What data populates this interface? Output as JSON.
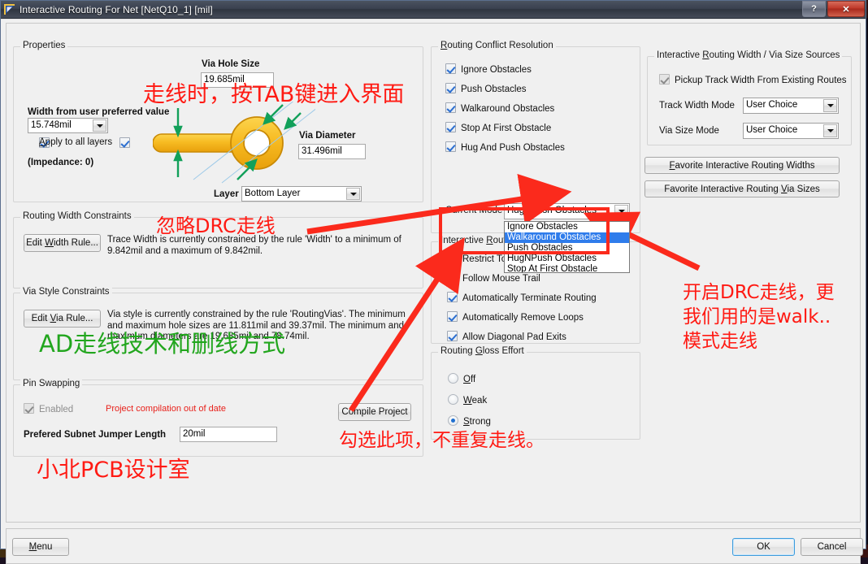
{
  "window": {
    "title": "Interactive Routing For Net [NetQ10_1] [mil]",
    "icon": "altium-pcb-icon",
    "help_label": "?",
    "close_label": "✕"
  },
  "properties": {
    "group_title": "Properties",
    "via_hole_size_label": "Via Hole Size",
    "via_hole_size_value": "19.685mil",
    "via_diameter_label": "Via Diameter",
    "via_diameter_value": "31.496mil",
    "width_label": "Width from user preferred value",
    "width_value": "15.748mil",
    "apply_all_layers_label": "Apply to all layers",
    "impedance_label": "(Impedance: 0)",
    "layer_label": "Layer",
    "layer_value": "Bottom Layer"
  },
  "routing_width_constraints": {
    "group_title": "Routing Width Constraints",
    "edit_button": "Edit Width Rule...",
    "description": "Trace Width is currently constrained by the rule 'Width' to a minimum of 9.842mil and a maximum of 9.842mil."
  },
  "via_style_constraints": {
    "group_title": "Via Style Constraints",
    "edit_button": "Edit Via Rule...",
    "description": "Via style is currently constrained by the rule 'RoutingVias'. The minimum and maximum hole sizes are 11.811mil and 39.37mil. The minimum and maximum diameters are 19.685mil and 78.74mil."
  },
  "pin_swapping": {
    "group_title": "Pin Swapping",
    "enabled_label": "Enabled",
    "warning": "Project compilation out of date",
    "compile_button": "Compile Project",
    "jumper_label": "Prefered Subnet Jumper Length",
    "jumper_value": "20mil"
  },
  "conflict_resolution": {
    "group_title": "Routing Conflict Resolution",
    "items": [
      {
        "label": "Ignore Obstacles",
        "checked": true
      },
      {
        "label": "Push Obstacles",
        "checked": true
      },
      {
        "label": "Walkaround Obstacles",
        "checked": true
      },
      {
        "label": "Stop At First Obstacle",
        "checked": true
      },
      {
        "label": "Hug And Push Obstacles",
        "checked": true
      }
    ],
    "current_mode_label": "Current Mode",
    "current_mode_value": "HugNPush Obstacles",
    "dropdown_options": [
      "Ignore Obstacles",
      "Walkaround Obstacles",
      "Push Obstacles",
      "HugNPush Obstacles",
      "Stop At First Obstacle"
    ],
    "dropdown_selected": "Walkaround Obstacles"
  },
  "routing_options": {
    "group_title": "Interactive Routing Options",
    "items": [
      {
        "label": "Restrict To 90/45",
        "checked": false
      },
      {
        "label": "Follow Mouse Trail",
        "checked": false
      },
      {
        "label": "Automatically Terminate Routing",
        "checked": true
      },
      {
        "label": "Automatically Remove Loops",
        "checked": true
      },
      {
        "label": "Allow Diagonal Pad Exits",
        "checked": true
      }
    ]
  },
  "gloss_effort": {
    "group_title": "Routing Gloss Effort",
    "options": [
      "Off",
      "Weak",
      "Strong"
    ],
    "selected": "Strong"
  },
  "width_sources": {
    "group_title": "Interactive Routing Width / Via Size Sources",
    "pickup_label": "Pickup Track Width From Existing Routes",
    "track_width_mode_label": "Track Width Mode",
    "track_width_mode_value": "User Choice",
    "via_size_mode_label": "Via Size Mode",
    "via_size_mode_value": "User Choice",
    "fav_widths_button": "Favorite Interactive Routing Widths",
    "fav_via_button": "Favorite Interactive Routing Via Sizes"
  },
  "footer": {
    "menu_button": "Menu",
    "ok_button": "OK",
    "cancel_button": "Cancel"
  },
  "annotations": {
    "tab_key": "走线时，按TAB键进入界面",
    "ignore_drc": "忽略DRC走线",
    "ad_tech": "AD走线技术和删线方式",
    "drc_line1": "开启DRC走线，更",
    "drc_line2": "我们用的是walk..",
    "drc_line3": "模式走线",
    "check_item": "勾选此项，不重复走线。",
    "studio": "小北PCB设计室"
  },
  "colors": {
    "annotation_red": "#ff1a13",
    "annotation_green": "#22a61e",
    "via_copper": "#f5b820",
    "selection_blue": "#2f7ceb"
  }
}
